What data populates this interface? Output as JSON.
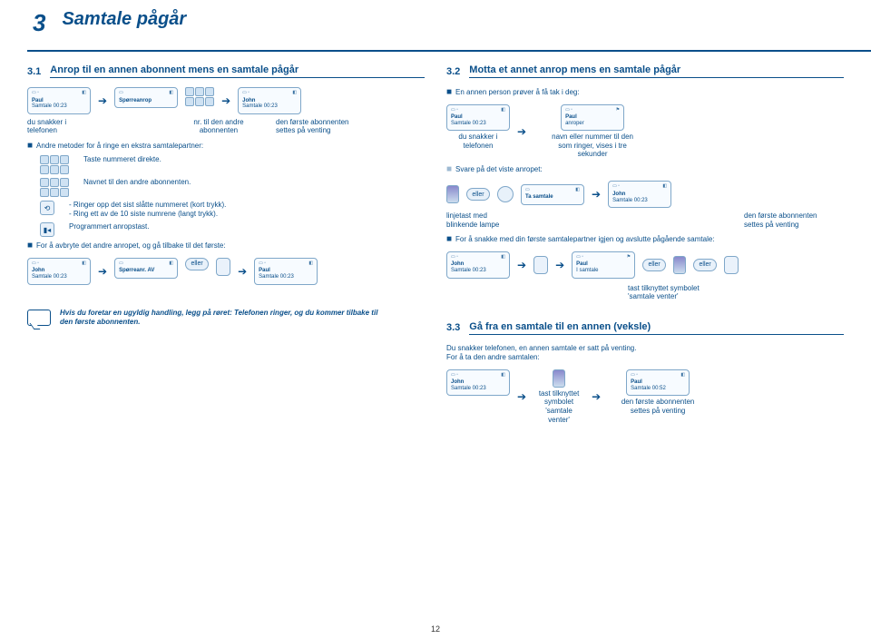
{
  "chapter": {
    "number": "3",
    "title": "Samtale pågår"
  },
  "left": {
    "sec31": {
      "num": "3.1",
      "title": "Anrop til en annen abonnent mens en samtale pågår"
    },
    "screen1": {
      "name": "Paul",
      "status": "Samtale 00:23"
    },
    "screen2": {
      "title": "Spørreanrop"
    },
    "screen3": {
      "name": "John",
      "status": "Samtale 00:23"
    },
    "cap_left": "du snakker i\ntelefonen",
    "cap_mid": "nr. til den andre\nabonnenten",
    "cap_right": "den første abonnenten\nsettes på venting",
    "andre": "Andre metoder for å ringe en ekstra samtalepartner:",
    "taste": "Taste nummeret direkte.",
    "navnet": "Navnet til den andre abonnenten.",
    "ringer_lines": "- Ringer opp det sist slåtte nummeret (kort trykk).\n- Ring ett av de 10 siste numrene (langt trykk).",
    "prog": "Programmert anropstast.",
    "avbryte": "For å avbryte det andre anropet, og gå tilbake til det første:",
    "screen4": {
      "name": "John",
      "status": "Samtale 00:23"
    },
    "screen5": {
      "title": "Spørreanr. AV"
    },
    "ell": "eller",
    "screen6": {
      "name": "Paul",
      "status": "Samtale 00:23"
    },
    "warn": "Hvis du foretar en ugyldig handling, legg på røret: Telefonen ringer, og du kommer tilbake til den første abonnenten."
  },
  "right": {
    "sec32": {
      "num": "3.2",
      "title": "Motta et annet anrop mens en samtale pågår"
    },
    "intro": "En annen person prøver å få tak i deg:",
    "screenA": {
      "name": "Paul",
      "status": "Samtale 00:23"
    },
    "screenB": {
      "name": "Paul",
      "status": "anroper"
    },
    "capA": "du snakker i\ntelefonen",
    "capB": "navn eller nummer til den\nsom ringer, vises i tre\nsekunder",
    "svare": "Svare på det viste anropet:",
    "ell": "eller",
    "screenC": {
      "title": "Ta samtale"
    },
    "screenD": {
      "name": "John",
      "status": "Samtale 00:23"
    },
    "capLamp": "linjetast med\nblinkende lampe",
    "capD": "den første abonnenten\nsettes på venting",
    "snakke": "For å snakke med din første samtalepartner igjen og avslutte pågående samtale:",
    "screenE": {
      "name": "John",
      "status": "Samtale 00:23"
    },
    "screenF": {
      "name": "Paul",
      "status": "I samtale"
    },
    "capF": "tast tilknyttet symbolet\n'samtale venter'",
    "sec33": {
      "num": "3.3",
      "title": "Gå fra en samtale til en annen (veksle)"
    },
    "line33a": "Du snakker telefonen, en annen samtale er satt på venting.",
    "line33b": "For å ta den andre samtalen:",
    "screenG": {
      "name": "John",
      "status": "Samtale 00:23"
    },
    "screenH": {
      "name": "Paul",
      "status": "Samtale 00:52"
    },
    "capG": "tast tilknyttet\nsymbolet\n'samtale\nventer'",
    "capH": "den første abonnenten\nsettes på venting"
  },
  "footer": {
    "page": "12"
  }
}
